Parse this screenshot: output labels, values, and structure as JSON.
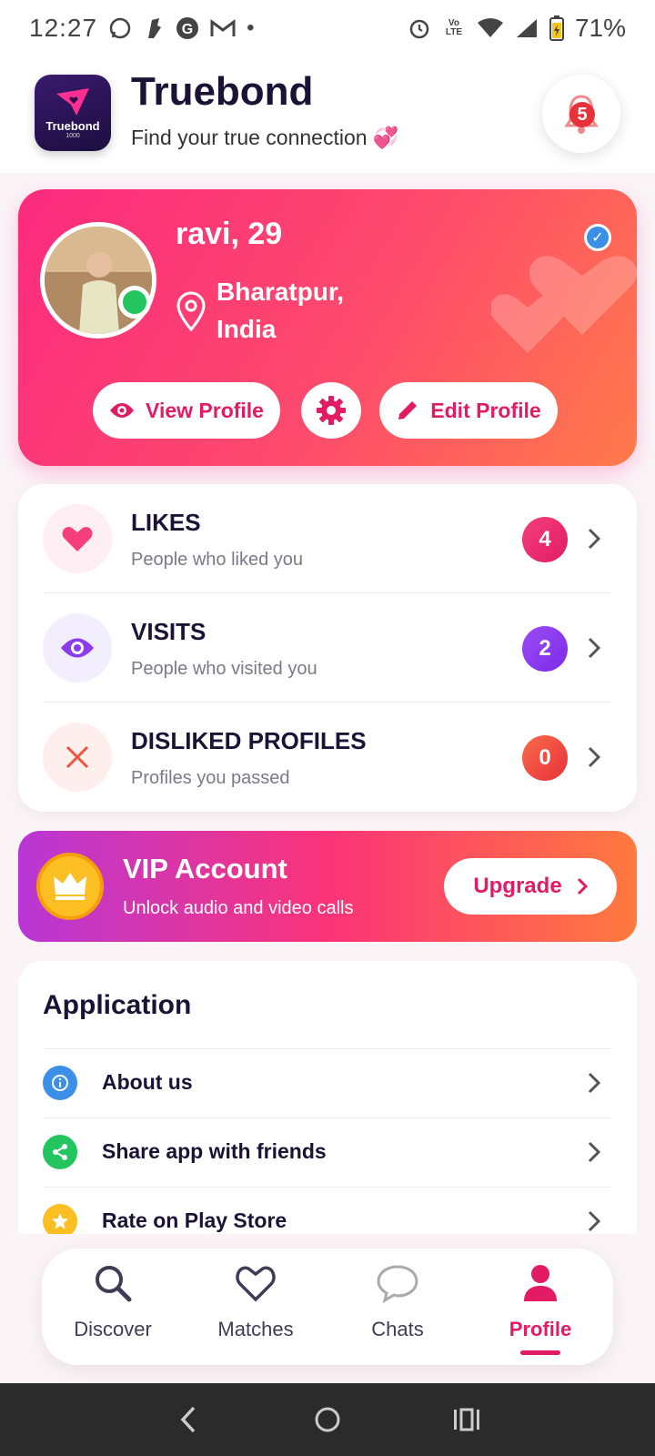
{
  "status_bar": {
    "time": "12:27",
    "battery": "71%",
    "network": "Vo LTE"
  },
  "header": {
    "logo_text": "Truebond",
    "logo_sub": "1000",
    "title": "Truebond",
    "tagline": "Find your true connection 💞",
    "notification_count": "5"
  },
  "profile": {
    "name_age": "ravi, 29",
    "location": "Bharatpur, India",
    "online": true,
    "verified": true,
    "view_profile_label": "View Profile",
    "edit_profile_label": "Edit Profile"
  },
  "stats": [
    {
      "title": "LIKES",
      "subtitle": "People who liked you",
      "count": "4",
      "icon": "heart-icon",
      "color": "#f43f7a",
      "bg": "#ffeef3"
    },
    {
      "title": "VISITS",
      "subtitle": "People who visited you",
      "count": "2",
      "icon": "eye-icon",
      "color": "#8b3cf0",
      "bg": "#f3eefe"
    },
    {
      "title": "DISLIKED PROFILES",
      "subtitle": "Profiles you passed",
      "count": "0",
      "icon": "x-icon",
      "color": "#f0533e",
      "bg": "#feeeee"
    }
  ],
  "vip": {
    "title": "VIP Account",
    "subtitle": "Unlock audio and video calls",
    "button_label": "Upgrade"
  },
  "application": {
    "title": "Application",
    "items": [
      {
        "label": "About us",
        "icon": "info-icon",
        "color": "#3b8fe6"
      },
      {
        "label": "Share app with friends",
        "icon": "share-icon",
        "color": "#22c55e"
      },
      {
        "label": "Rate on Play Store",
        "icon": "star-icon",
        "color": "#fbbf24"
      }
    ]
  },
  "bottom_nav": {
    "items": [
      {
        "label": "Discover",
        "icon": "search-icon",
        "active": false
      },
      {
        "label": "Matches",
        "icon": "heart-outline-icon",
        "active": false
      },
      {
        "label": "Chats",
        "icon": "chat-bubble-icon",
        "active": false
      },
      {
        "label": "Profile",
        "icon": "person-icon",
        "active": true
      }
    ]
  },
  "colors": {
    "accent": "#e21b64",
    "card_gradient_start": "#fb2a7e",
    "card_gradient_end": "#ff7a4a"
  }
}
